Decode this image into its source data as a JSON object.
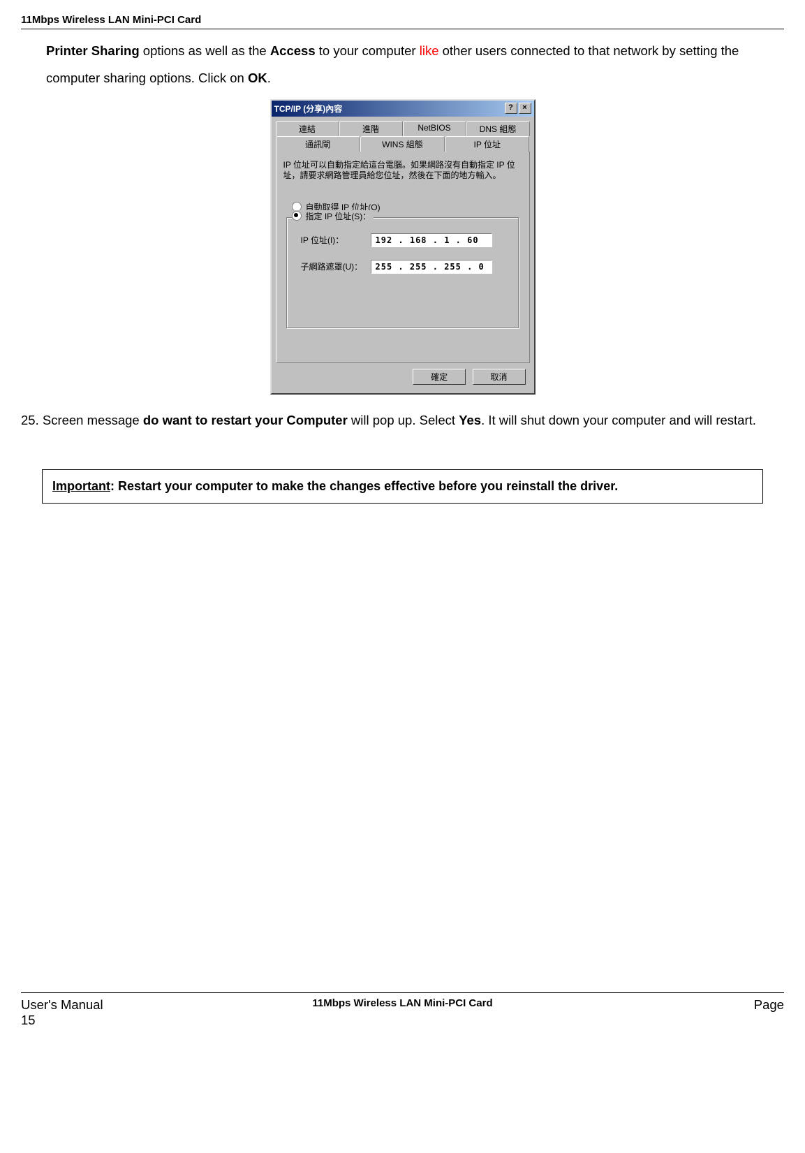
{
  "header": {
    "title": "11Mbps Wireless LAN Mini-PCI Card"
  },
  "para1": {
    "t1": "Printer Sharing",
    "t2": " options as well as the ",
    "t3": "Access",
    "t4": " to your computer ",
    "t5": "like",
    "t6": " other users connected to that network by setting the computer sharing options. Click on ",
    "t7": "OK",
    "t8": "."
  },
  "dialog": {
    "title": "TCP/IP (分享)內容",
    "helpIcon": "?",
    "closeIcon": "×",
    "tabs_row1": [
      "連結",
      "進階",
      "NetBIOS",
      "DNS 組態"
    ],
    "tabs_row2": [
      "通訊閘",
      "WINS 組態",
      "IP 位址"
    ],
    "activeTab": "IP 位址",
    "desc": "IP 位址可以自動指定給這台電腦。如果網路沒有自動指定 IP 位址，請要求網路管理員給您位址，然後在下面的地方輸入。",
    "radio_auto": "自動取得 IP 位址(O)",
    "radio_manual": "指定 IP 位址(S)：",
    "label_ip": "IP 位址(I)：",
    "value_ip": "192 . 168 .   1   .  60",
    "label_mask": "子網路遮罩(U)：",
    "value_mask": "255 . 255 . 255 .   0",
    "btn_ok": "確定",
    "btn_cancel": "取消"
  },
  "para25": {
    "num": "25. ",
    "t1": "Screen message ",
    "t2": "do want to restart your Computer",
    "t3": " will pop up. Select ",
    "t4": "Yes",
    "t5": ". It will shut down your computer and will restart."
  },
  "important": {
    "label": "Important",
    "text": ": Restart your computer to make the changes effective before you reinstall the driver."
  },
  "footer": {
    "left": "User's Manual",
    "center": "11Mbps Wireless LAN Mini-PCI Card",
    "right": "Page",
    "pagenum": "15"
  }
}
